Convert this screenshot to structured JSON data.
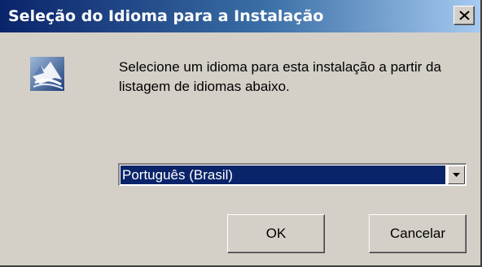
{
  "window": {
    "title": "Seleção do Idioma para a Instalação",
    "close_label": "X"
  },
  "icons": {
    "app": "installer-logo-icon",
    "close": "close-icon",
    "dropdown": "chevron-down-icon"
  },
  "content": {
    "message": "Selecione um idioma para esta instalação a partir da listagem de idiomas abaixo."
  },
  "language_select": {
    "selected": "Português (Brasil)"
  },
  "buttons": {
    "ok": "OK",
    "cancel": "Cancelar"
  },
  "colors": {
    "title_gradient_start": "#0a246a",
    "title_gradient_end": "#a6caf0",
    "selection": "#0a246a",
    "face": "#d4d0c8"
  }
}
